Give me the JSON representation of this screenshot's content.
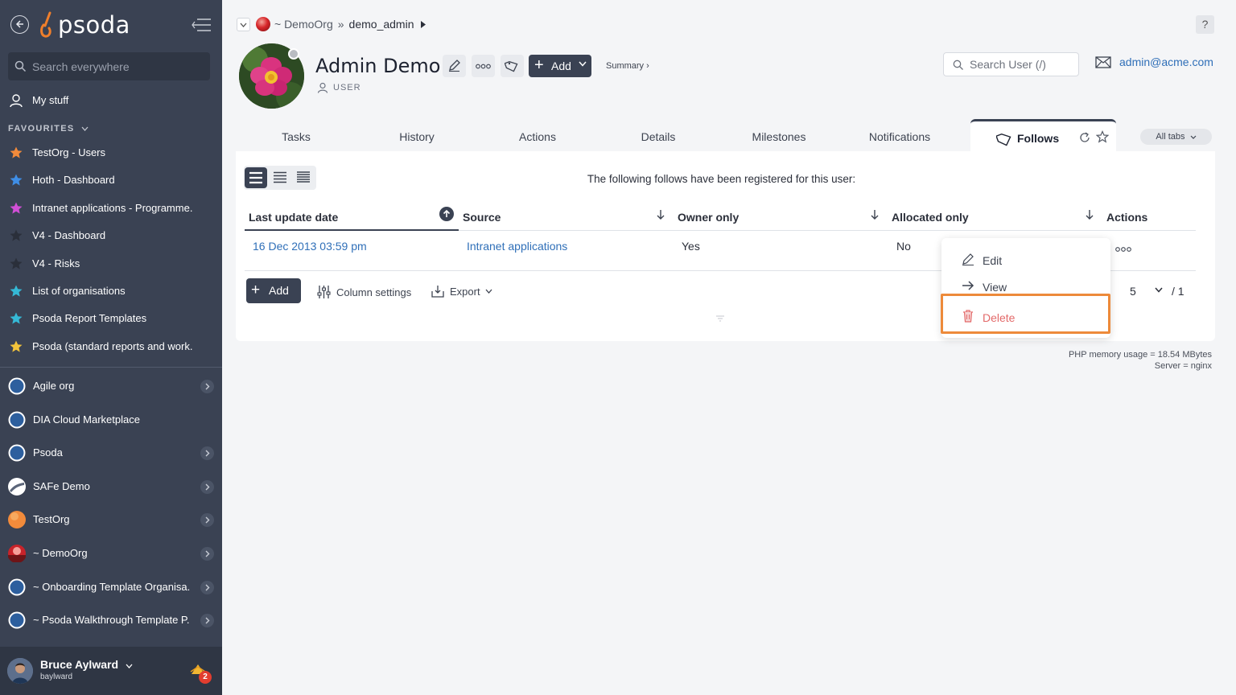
{
  "app": {
    "logo_text": "psoda",
    "brand_color": "#f07f2b",
    "sidebar_color": "#3a4253"
  },
  "sidebar": {
    "search_placeholder": "Search everywhere",
    "my_stuff": "My stuff",
    "favourites_heading": "FAVOURITES",
    "favourites": [
      {
        "label": "TestOrg - Users",
        "star_color": "#f28b3b"
      },
      {
        "label": "Hoth - Dashboard",
        "star_color": "#3f8ee6"
      },
      {
        "label": "Intranet applications - Programme...",
        "star_color": "#d14fd6"
      },
      {
        "label": "V4 - Dashboard",
        "star_color": "#2a2f3a"
      },
      {
        "label": "V4 - Risks",
        "star_color": "#2a2f3a"
      },
      {
        "label": "List of organisations",
        "star_color": "#35b9d6"
      },
      {
        "label": "Psoda Report Templates",
        "star_color": "#35b9d6"
      },
      {
        "label": "Psoda (standard reports and work...",
        "star_color": "#f2c33b"
      }
    ],
    "orgs": [
      {
        "label": "Agile org",
        "icon": "compass-icon"
      },
      {
        "label": "DIA Cloud Marketplace",
        "icon": "compass-icon"
      },
      {
        "label": "Psoda",
        "icon": "compass-icon"
      },
      {
        "label": "SAFe Demo",
        "icon": "safe-logo"
      },
      {
        "label": "TestOrg",
        "icon": "orange-circle"
      },
      {
        "label": "~ DemoOrg",
        "icon": "red-sunset"
      },
      {
        "label": "~ Onboarding Template Organisa...",
        "icon": "compass-icon"
      },
      {
        "label": "~ Psoda Walkthrough Template P...",
        "icon": "compass-icon"
      }
    ],
    "user": {
      "name": "Bruce Aylward",
      "login": "baylward",
      "notifications": "2"
    }
  },
  "header": {
    "breadcrumb": {
      "org": "~ DemoOrg",
      "sep": "»",
      "current": "demo_admin"
    },
    "help": "?",
    "title": "Admin Demo",
    "role": "USER",
    "add_label": "Add",
    "summary_link": "Summary ›",
    "search_placeholder": "Search User (/)",
    "email": "admin@acme.com"
  },
  "tabs": {
    "items": [
      "Tasks",
      "History",
      "Actions",
      "Details",
      "Milestones",
      "Notifications"
    ],
    "active": "Follows",
    "all_tabs": "All tabs"
  },
  "panel": {
    "intro": "The following follows have been registered for this user:",
    "columns": [
      "Last update date",
      "Source",
      "Owner only",
      "Allocated only",
      "Actions"
    ],
    "rows": [
      {
        "last_update": "16 Dec 2013 03:59 pm",
        "source": "Intranet applications",
        "owner_only": "Yes",
        "allocated_only": "No",
        "actions": "ooo"
      }
    ],
    "add_label": "Add",
    "column_settings": "Column settings",
    "export": "Export",
    "page_size": "5",
    "page_total": "/ 1"
  },
  "context_menu": {
    "edit": "Edit",
    "view": "View",
    "delete": "Delete"
  },
  "footer": {
    "memory": "PHP memory usage = 18.54 MBytes",
    "server": "Server = nginx"
  }
}
